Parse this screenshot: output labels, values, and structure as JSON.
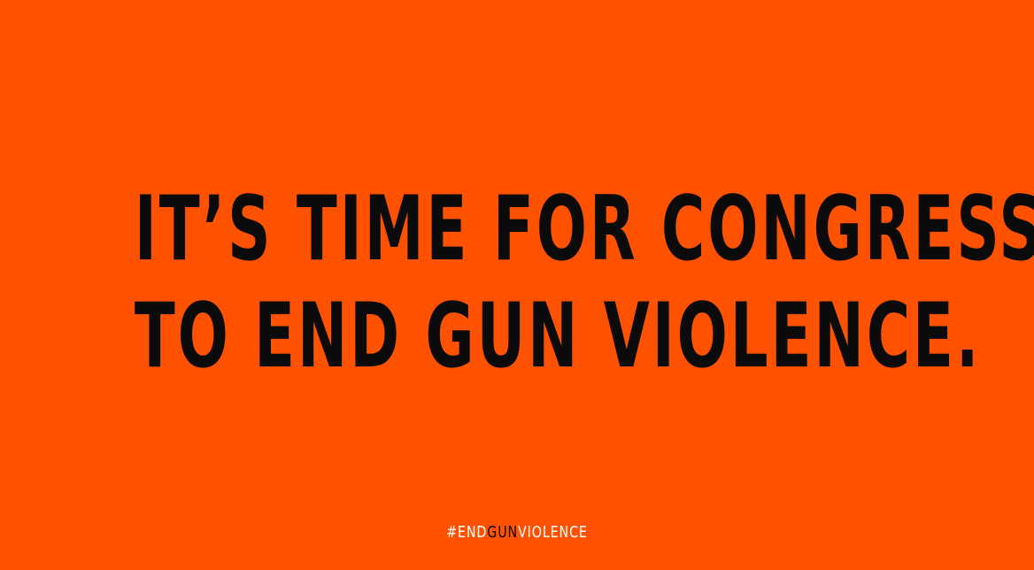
{
  "poster": {
    "background_color": "#ff5200",
    "text_color": "#0b0b0b",
    "headline": {
      "line1": "IT’S TIME FOR CONGRESS",
      "line2": "TO END GUN VIOLENCE."
    },
    "hashtag": {
      "part1": "#END",
      "part2": "GUN",
      "part3": "VIOLENCE",
      "part1_color": "#ffffff",
      "part2_color": "#0b0b0b",
      "part3_color": "#ffffff"
    }
  }
}
